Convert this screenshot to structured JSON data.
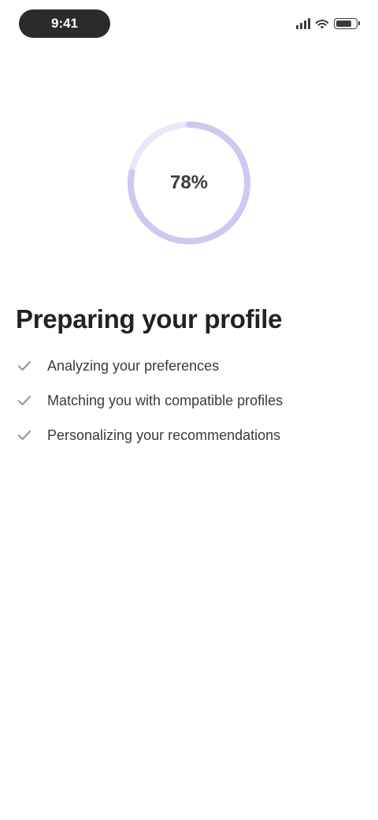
{
  "status_bar": {
    "time": "9:41",
    "battery_level": 0.85,
    "icons": [
      "cellular-signal-icon",
      "wifi-icon",
      "battery-icon"
    ]
  },
  "progress": {
    "percent": 0.78,
    "label": "78%",
    "ring_color": "#cfc8f0",
    "track_color": "#ebe7fa"
  },
  "title": "Preparing your profile",
  "steps": [
    {
      "label": "Analyzing your preferences",
      "icon": "check-icon"
    },
    {
      "label": "Matching you with compatible profiles",
      "icon": "check-icon"
    },
    {
      "label": "Personalizing your recommendations",
      "icon": "check-icon"
    }
  ],
  "colors": {
    "check": "#9a9a9a",
    "text": "#3a3a3a"
  }
}
